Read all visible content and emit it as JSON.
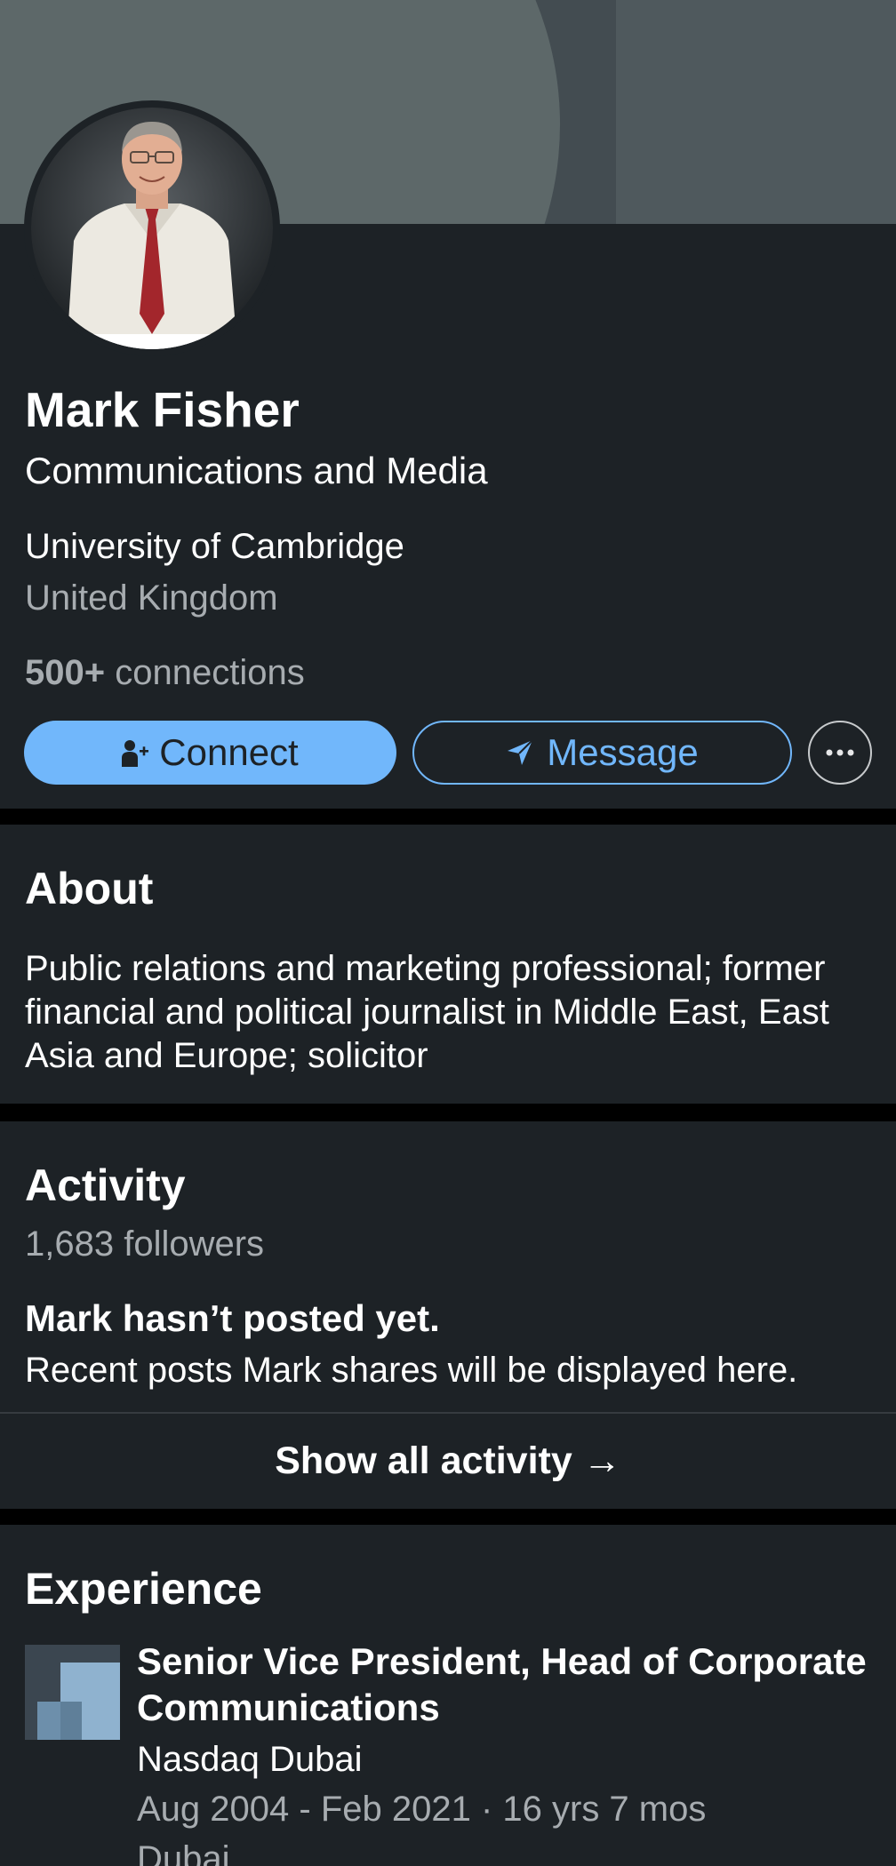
{
  "profile": {
    "name": "Mark Fisher",
    "headline": "Communications and Media",
    "school": "University of Cambridge",
    "location": "United Kingdom",
    "connections_count": "500+",
    "connections_label": "connections",
    "avatar_icon": "profile-photo"
  },
  "actions": {
    "connect_label": "Connect",
    "connect_icon": "add-person-icon",
    "message_label": "Message",
    "message_icon": "send-icon",
    "more_icon": "more-icon"
  },
  "about": {
    "title": "About",
    "text": "Public relations and marketing professional; former financial and political journalist in Middle East, East Asia and Europe; solicitor"
  },
  "activity": {
    "title": "Activity",
    "followers": "1,683 followers",
    "empty_title": "Mark hasn’t posted yet.",
    "empty_body": "Recent posts Mark shares will be displayed here.",
    "show_all_label": "Show all activity",
    "show_all_arrow": "→"
  },
  "experience": {
    "title": "Experience",
    "items": [
      {
        "title": "Senior Vice President, Head of Corporate Communications",
        "company": "Nasdaq Dubai",
        "dates": "Aug 2004 - Feb 2021 · 16 yrs 7 mos",
        "location": "Dubai"
      }
    ]
  },
  "colors": {
    "card_background": "#1d2226",
    "page_background": "#000000",
    "accent_blue": "#71b7fb",
    "secondary_text": "#a7acb0"
  }
}
